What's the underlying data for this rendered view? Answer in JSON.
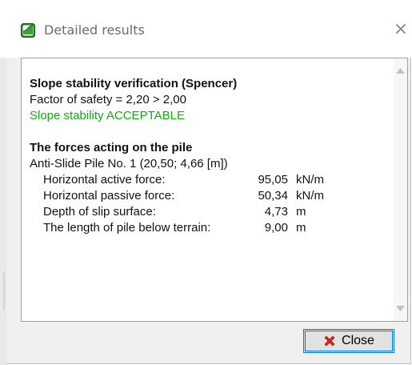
{
  "window": {
    "title": "Detailed results",
    "close_glyph": "×"
  },
  "icons": {
    "app": "app-icon",
    "window_close": "close-icon",
    "button_close": "red-x-icon",
    "scroll_up": "arrow-up-icon",
    "scroll_down": "arrow-down-icon"
  },
  "colors": {
    "acceptable": "#14a814",
    "button_focus": "#0078d7",
    "close_x": "#e02020"
  },
  "content": {
    "section1": {
      "heading": "Slope stability verification (Spencer)",
      "factor_line": "Factor of safety = 2,20 > 2,00",
      "status": "Slope stability ACCEPTABLE"
    },
    "section2": {
      "heading": "The forces acting on the pile",
      "pile_line": "Anti-Slide Pile No. 1 (20,50; 4,66 [m])",
      "rows": [
        {
          "label": "Horizontal active force:",
          "value": "95,05",
          "unit": "kN/m"
        },
        {
          "label": "Horizontal passive force:",
          "value": "50,34",
          "unit": "kN/m"
        },
        {
          "label": "Depth of slip surface:",
          "value": "4,73",
          "unit": "m"
        },
        {
          "label": "The length of pile below terrain:",
          "value": "9,00",
          "unit": "m"
        }
      ]
    }
  },
  "buttons": {
    "close_label": "Close"
  }
}
